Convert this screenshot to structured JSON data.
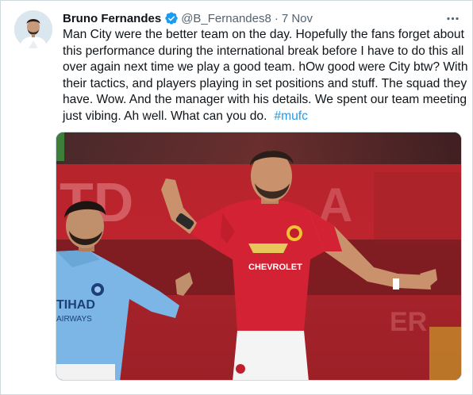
{
  "tweet": {
    "author_name": "Bruno Fernandes",
    "handle": "@B_Fernandes8",
    "separator": "·",
    "date": "7 Nov",
    "verified_icon": "verified-badge-icon",
    "more_icon": "more-horizontal-icon",
    "text_lines": [
      "Man City were the better team on the day. Hopefully the fans forget about",
      "this performance during the international break before I have to do this all",
      "over again next time we play a good team. hOw good were City btw? With",
      "their tactics, and players playing in set positions and stuff. The squad they",
      "have. Wow. And the manager with his details. We spent our team meeting"
    ],
    "last_line": "just vibing. Ah well. What can you do.",
    "hashtag": "#mufc"
  },
  "media": {
    "description_icon": "photo-football-match",
    "sponsor_text": "CHEVROLET",
    "city_shirt_text_1": "TIHAD",
    "city_shirt_text_2": "AIRWAYS"
  },
  "colors": {
    "accent": "#1d9bf0",
    "text": "#0f1419",
    "secondary": "#536471",
    "border": "#cfd9de",
    "united_red": "#d32233",
    "city_blue": "#7bb6e6"
  }
}
